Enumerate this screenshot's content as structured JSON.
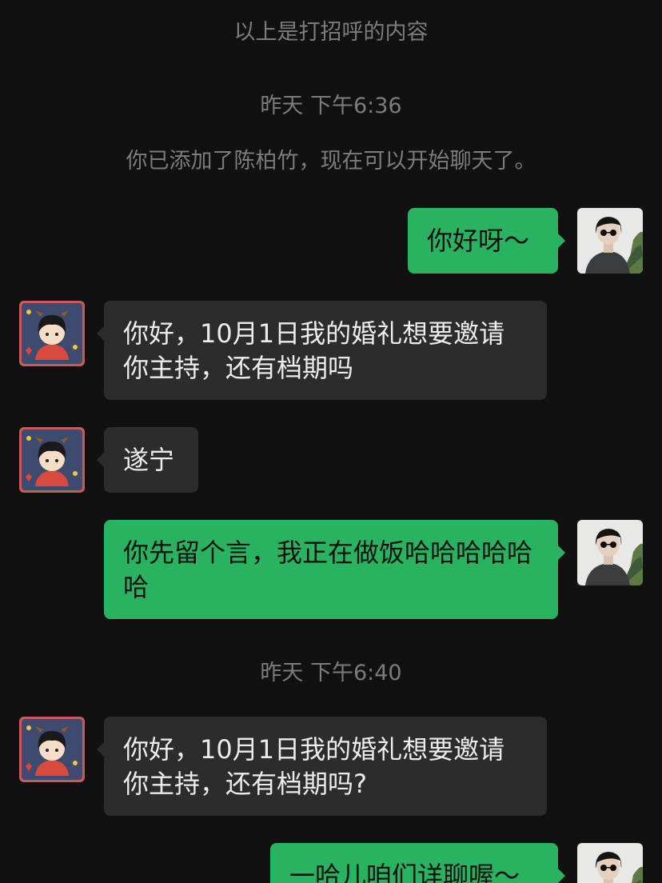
{
  "system_messages": [
    "以上是打招呼的内容",
    "昨天 下午6:36",
    "你已添加了陈柏竹，现在可以开始聊天了。",
    "昨天 下午6:40"
  ],
  "messages": [
    {
      "side": "out",
      "text": "你好呀～"
    },
    {
      "side": "in",
      "text": "你好，10月1日我的婚礼想要邀请你主持，还有档期吗"
    },
    {
      "side": "in",
      "text": "遂宁"
    },
    {
      "side": "out",
      "text": "你先留个言，我正在做饭哈哈哈哈哈哈"
    },
    {
      "side": "in",
      "text": "你好，10月1日我的婚礼想要邀请你主持，还有档期吗?"
    },
    {
      "side": "out",
      "text": "一哈儿咱们详聊喔～"
    }
  ],
  "colors": {
    "background": "#111111",
    "incoming_bubble": "#2c2c2c",
    "outgoing_bubble": "#29b260",
    "system_text": "#7c7c7c"
  }
}
